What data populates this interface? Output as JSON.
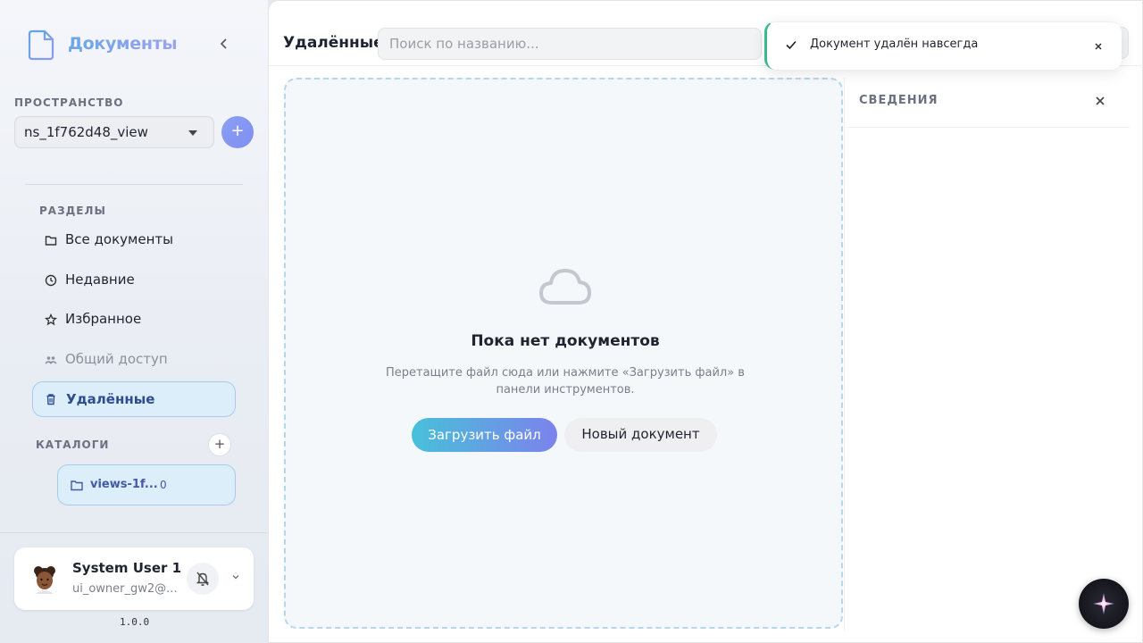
{
  "app": {
    "title": "Документы",
    "version": "1.0.0"
  },
  "sidebar": {
    "workspace_label": "ПРОСТРАНСТВО",
    "workspace_value": "ns_1f762d48_view",
    "workspace_add": "+",
    "sections_label": "РАЗДЕЛЫ",
    "items": [
      {
        "label": "Все документы",
        "icon": "folder-icon",
        "state": "normal"
      },
      {
        "label": "Недавние",
        "icon": "clock-icon",
        "state": "normal"
      },
      {
        "label": "Избранное",
        "icon": "star-icon",
        "state": "normal"
      },
      {
        "label": "Общий доступ",
        "icon": "users-icon",
        "state": "disabled"
      },
      {
        "label": "Удалённые",
        "icon": "trash-icon",
        "state": "active"
      }
    ],
    "catalogs_label": "КАТАЛОГИ",
    "catalog_add": "+",
    "catalogs": [
      {
        "name": "views-1f...",
        "count": "0"
      }
    ],
    "user": {
      "name": "System User 1",
      "email": "ui_owner_gw2@..."
    }
  },
  "main": {
    "title": "Удалённые",
    "search_placeholder": "Поиск по названию...",
    "empty": {
      "title": "Пока нет документов",
      "description": "Перетащите файл сюда или нажмите «Загрузить файл» в панели инструментов.",
      "upload_label": "Загрузить файл",
      "new_doc_label": "Новый документ"
    },
    "details": {
      "title": "СВЕДЕНИЯ"
    }
  },
  "toast": {
    "message": "Документ удалён навсегда",
    "status_color": "#3bb98a"
  },
  "colors": {
    "accent": "#7f8ef0",
    "active_bg": "#dceefa",
    "active_border": "#a9cbee"
  }
}
